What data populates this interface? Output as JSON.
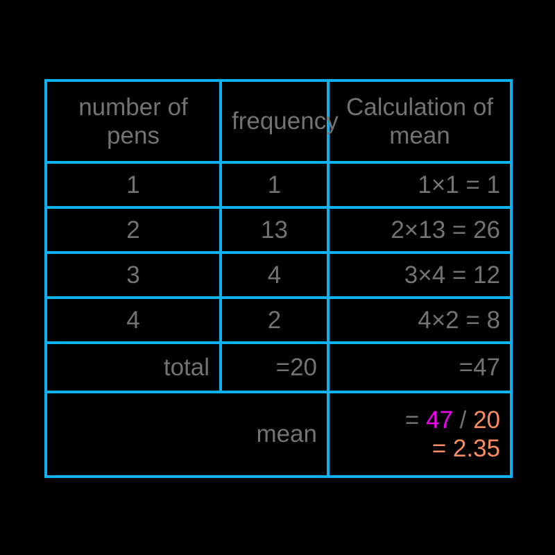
{
  "table": {
    "headers": [
      {
        "label": "number of pens",
        "align": "center"
      },
      {
        "label": "frequency",
        "align": "center"
      },
      {
        "label": "Calculation of mean",
        "align": "center"
      }
    ],
    "rows": [
      {
        "pens": "1",
        "frequency": "1",
        "calculation": "1×1 = 1"
      },
      {
        "pens": "2",
        "frequency": "13",
        "calculation": "2×13 = 26"
      },
      {
        "pens": "3",
        "frequency": "4",
        "calculation": "3×4 = 12"
      },
      {
        "pens": "4",
        "frequency": "2",
        "calculation": "4×2 = 8"
      }
    ],
    "total_row": {
      "label": "total",
      "frequency_total": "=20",
      "calculation_total": "=47"
    },
    "mean_row": {
      "label": "mean",
      "line1": {
        "equals": "= ",
        "numerator": "47",
        "divider": " / ",
        "denominator": "20"
      },
      "line2": "= 2.35"
    }
  },
  "colors": {
    "border": "#0fb2f0",
    "text": "#737373",
    "background": "#000000",
    "orange": "#fa8c60",
    "magenta": "#ee00ee"
  }
}
